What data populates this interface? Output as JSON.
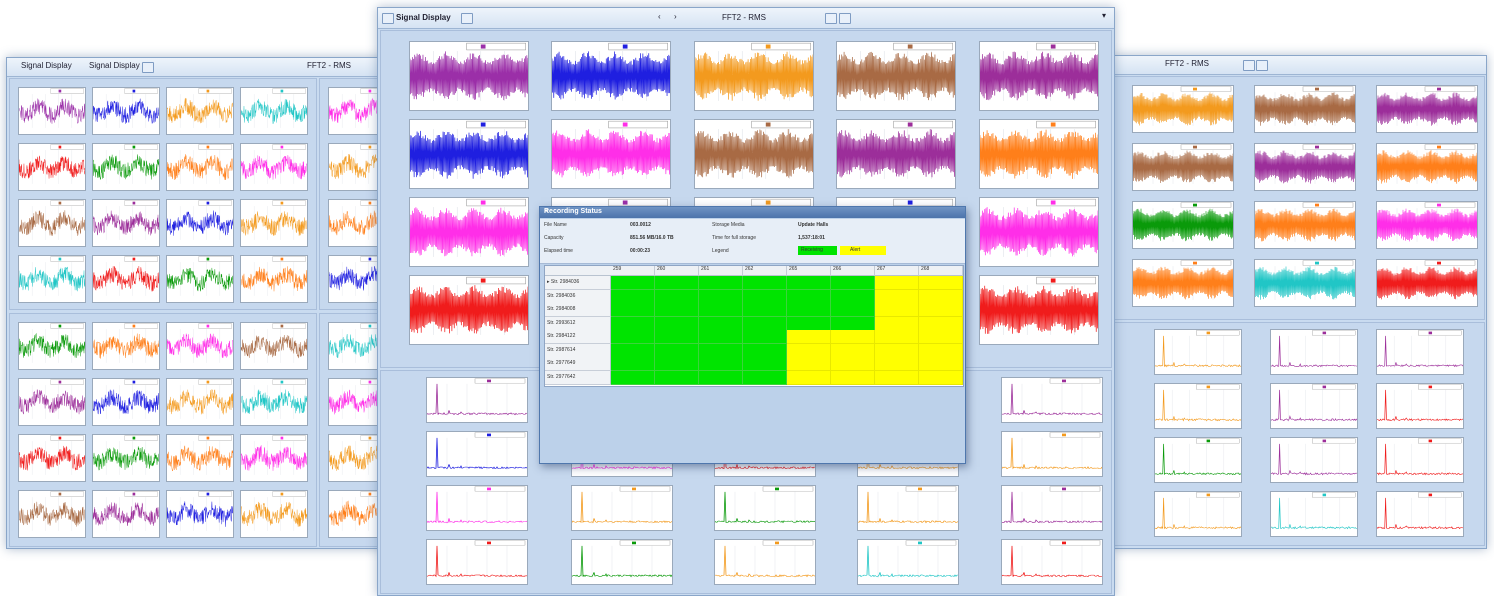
{
  "left_window": {
    "tab1": "Signal Display",
    "tab2": "Signal Display",
    "title": "FFT2 - RMS"
  },
  "center_window": {
    "title": "Signal Display",
    "center_title": "FFT2 - RMS"
  },
  "right_window": {
    "title": "FFT2 - RMS"
  },
  "recording_dialog": {
    "title": "Recording Status",
    "close": "×",
    "labels": {
      "file_name": "File Name",
      "capacity": "Capacity",
      "elapsed_time": "Elapsed time",
      "storage_media": "Storage Media",
      "time_for_full_storage": "Time for full storage",
      "legend": "Legend"
    },
    "values": {
      "file_name": "003.0012",
      "capacity": "851.56 MB/16.0 TB",
      "elapsed_time": "00:00:23",
      "storage_media": "Update Halls",
      "time_for_full_storage": "1,537:18:01"
    },
    "legend_ok": "Receiving",
    "legend_warn": "Alert",
    "grid_headers": [
      "259",
      "260",
      "261",
      "262",
      "265",
      "266",
      "267",
      "268"
    ],
    "rows": [
      {
        "label": "Str. 2984036",
        "cells": [
          "g",
          "g",
          "g",
          "g",
          "g",
          "g",
          "y",
          "y"
        ]
      },
      {
        "label": "Str. 2984036",
        "cells": [
          "g",
          "g",
          "g",
          "g",
          "g",
          "g",
          "y",
          "y"
        ]
      },
      {
        "label": "Str. 2984008",
        "cells": [
          "g",
          "g",
          "g",
          "g",
          "g",
          "g",
          "y",
          "y"
        ]
      },
      {
        "label": "Str. 2993612",
        "cells": [
          "g",
          "g",
          "g",
          "g",
          "g",
          "g",
          "y",
          "y"
        ]
      },
      {
        "label": "Str. 2984122",
        "cells": [
          "g",
          "g",
          "g",
          "g",
          "y",
          "y",
          "y",
          "y"
        ]
      },
      {
        "label": "Str. 2987614",
        "cells": [
          "g",
          "g",
          "g",
          "g",
          "y",
          "y",
          "y",
          "y"
        ]
      },
      {
        "label": "Str. 2977649",
        "cells": [
          "g",
          "g",
          "g",
          "g",
          "y",
          "y",
          "y",
          "y"
        ]
      },
      {
        "label": "Str. 2977642",
        "cells": [
          "g",
          "g",
          "g",
          "g",
          "y",
          "y",
          "y",
          "y"
        ]
      }
    ]
  },
  "colors": {
    "purple": "#9b2fa8",
    "blue": "#1f1fe0",
    "orange": "#f39a1e",
    "brown": "#a86a44",
    "violet": "#9c2e9a",
    "magenta": "#ff2ee8",
    "dark_orange": "#ff7f1a",
    "red": "#f01c1c",
    "green": "#0a9a0a",
    "cyan": "#21c6c6",
    "green_status": "#00e400",
    "yellow_status": "#ffff00"
  }
}
